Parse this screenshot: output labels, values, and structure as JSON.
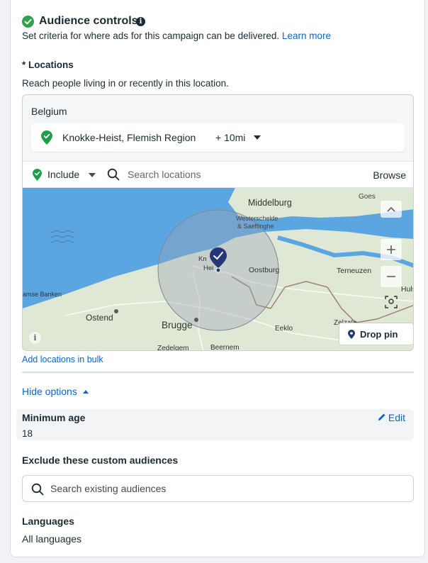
{
  "header": {
    "title": "Audience controls",
    "description": "Set criteria for where ads for this campaign can be delivered.",
    "learn_more": "Learn more"
  },
  "locations": {
    "label": "Locations",
    "required_marker": "*",
    "description": "Reach people living in or recently in this location.",
    "country": "Belgium",
    "selected": {
      "name": "Knokke-Heist, Flemish Region",
      "radius": "+ 10mi"
    },
    "include_label": "Include",
    "search_placeholder": "Search locations",
    "browse_label": "Browse",
    "map": {
      "labels": [
        "Middelburg",
        "Goes",
        "Westerschelde",
        "& Saeftinghe",
        "Oostburg",
        "Terneuzen",
        "Huls",
        "amse Banken",
        "Ostend",
        "Brugge",
        "Eeklo",
        "Zelzate",
        "Zedelgem",
        "Beernem",
        "Knokke-Heist",
        "Kn",
        "Hei"
      ],
      "drop_pin_label": "Drop pin",
      "colors": {
        "water": "#5ba6e0",
        "land": "#dfe8d4",
        "radius_fill": "#9aa3b5",
        "pin": "#243877"
      }
    },
    "bulk_link": "Add locations in bulk"
  },
  "options": {
    "hide_label": "Hide options",
    "min_age_label": "Minimum age",
    "min_age_value": "18",
    "edit_label": "Edit",
    "exclude_label": "Exclude these custom audiences",
    "exclude_placeholder": "Search existing audiences",
    "languages_label": "Languages",
    "languages_value": "All languages"
  }
}
